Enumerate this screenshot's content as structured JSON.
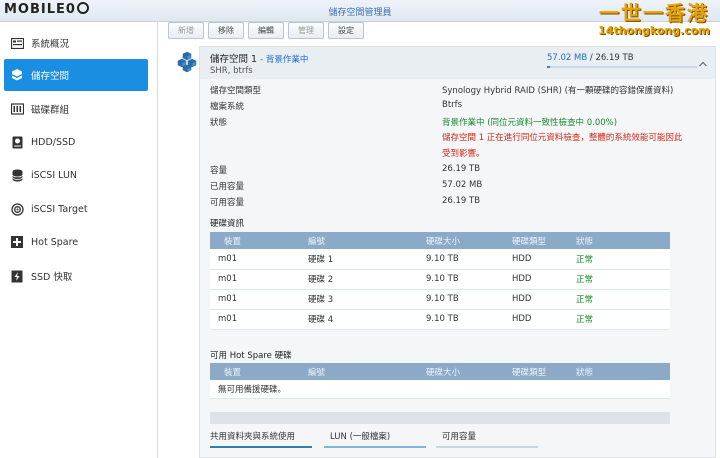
{
  "window": {
    "title": "儲存空間管理員"
  },
  "logo": {
    "text": "MOBILE",
    "alt": "MOBILE01 logo"
  },
  "watermark": {
    "line1": "一世一香港",
    "line2": "14thongkong.com"
  },
  "sidebar": {
    "items": [
      {
        "label": "系統概況",
        "icon": "overview-icon"
      },
      {
        "label": "儲存空間",
        "icon": "volume-icon",
        "active": true
      },
      {
        "label": "磁碟群組",
        "icon": "disk-group-icon"
      },
      {
        "label": "HDD/SSD",
        "icon": "hdd-icon"
      },
      {
        "label": "iSCSI LUN",
        "icon": "lun-icon"
      },
      {
        "label": "iSCSI Target",
        "icon": "target-icon"
      },
      {
        "label": "Hot Spare",
        "icon": "hot-spare-icon"
      },
      {
        "label": "SSD 快取",
        "icon": "ssd-cache-icon"
      }
    ]
  },
  "toolbar": {
    "new": "新增",
    "remove": "移除",
    "edit": "編輯",
    "manage": "管理",
    "settings": "設定"
  },
  "volume": {
    "name": "儲存空間 1",
    "status": "- 背景作業中",
    "subtitle": "SHR, btrfs",
    "used": "57.02 MB",
    "separator": "/",
    "total": "26.19 TB",
    "used_fraction": 0.02,
    "details": {
      "type_label": "儲存空間類型",
      "type_value": "Synology Hybrid RAID (SHR) (有一顆硬碟的容錯保護資料)",
      "fs_label": "檔案系統",
      "fs_value": "Btrfs",
      "status_label": "狀態",
      "status_value": "背景作業中 (同位元資料一致性檢查中 0.00%)",
      "warning_line1": "儲存空間 1 正在進行同位元資料檢查，整體的系統效能可能因此",
      "warning_line2": "受到影響。",
      "capacity_label": "容量",
      "capacity_value": "26.19 TB",
      "used_label": "已用容量",
      "used_value": "57.02 MB",
      "available_label": "可用容量",
      "available_value": "26.19 TB"
    }
  },
  "disk_info": {
    "title": "硬碟資訊",
    "columns": [
      "裝置",
      "編號",
      "硬碟大小",
      "硬碟類型",
      "狀態"
    ],
    "rows": [
      [
        "m01",
        "硬碟 1",
        "9.10 TB",
        "HDD",
        "正常"
      ],
      [
        "m01",
        "硬碟 2",
        "9.10 TB",
        "HDD",
        "正常"
      ],
      [
        "m01",
        "硬碟 3",
        "9.10 TB",
        "HDD",
        "正常"
      ],
      [
        "m01",
        "硬碟 4",
        "9.10 TB",
        "HDD",
        "正常"
      ]
    ]
  },
  "hot_spare": {
    "title": "可用 Hot Spare 硬碟",
    "columns": [
      "裝置",
      "編號",
      "硬碟大小",
      "硬碟類型",
      "狀態"
    ],
    "empty": "無可用備援硬碟。"
  },
  "legend": {
    "shared": "共用資料夾與系統使用",
    "lun": "LUN (一般檔案)",
    "available": "可用容量"
  },
  "colors": {
    "accent": "#1a8ee0",
    "ok": "#1a8a2e",
    "warning": "#d12a1a",
    "legend_shared": "#2f7fb3",
    "legend_lun": "#7fb6dc",
    "legend_available": "#c9d6e0"
  }
}
